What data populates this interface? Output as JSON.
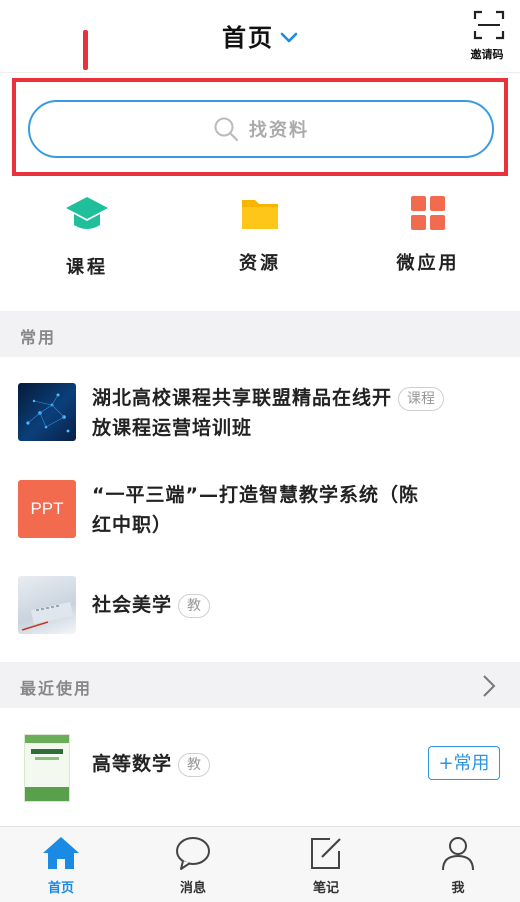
{
  "header": {
    "title": "首页",
    "scan_label": "邀请码"
  },
  "search": {
    "placeholder": "找资料"
  },
  "quick_entries": [
    {
      "label": "课程",
      "icon": "graduation-cap-icon",
      "color": "#1fbf9c"
    },
    {
      "label": "资源",
      "icon": "folder-icon",
      "color": "#f7b500"
    },
    {
      "label": "微应用",
      "icon": "grid-apps-icon",
      "color": "#f26b4f"
    }
  ],
  "frequent": {
    "title": "常用",
    "items": [
      {
        "title_line1": "湖北高校课程共享联盟精品在线开",
        "title_line2": "放课程运营培训班",
        "tag": "课程",
        "thumb": "tech-thumb"
      },
      {
        "title_line1": "“一平三端”—打造智慧教学系统（陈",
        "title_line2": "红中职）",
        "tag": "",
        "thumb": "ppt-thumb",
        "thumb_text": "PPT"
      },
      {
        "title_line1": "社会美学",
        "title_line2": "",
        "tag": "教",
        "thumb": "desk-thumb"
      }
    ]
  },
  "recent": {
    "title": "最近使用",
    "items": [
      {
        "title": "高等数学",
        "tag": "教",
        "button": "+常用"
      }
    ]
  },
  "tabbar": [
    {
      "label": "首页",
      "icon": "home-icon",
      "active": true
    },
    {
      "label": "消息",
      "icon": "chat-bubble-icon",
      "active": false
    },
    {
      "label": "笔记",
      "icon": "note-edit-icon",
      "active": false
    },
    {
      "label": "我",
      "icon": "user-icon",
      "active": false
    }
  ],
  "colors": {
    "accent": "#1a8ae5",
    "highlight": "#e8323c",
    "section_bg": "#f2f2f4"
  }
}
